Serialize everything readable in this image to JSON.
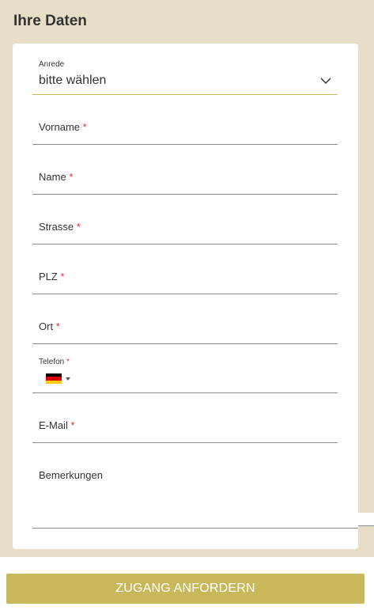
{
  "section": {
    "title": "Ihre Daten"
  },
  "form": {
    "anrede": {
      "label": "Anrede",
      "value": "bitte wählen"
    },
    "vorname": {
      "label": "Vorname",
      "required": "*"
    },
    "name": {
      "label": "Name",
      "required": "*"
    },
    "strasse": {
      "label": "Strasse",
      "required": "*"
    },
    "plz": {
      "label": "PLZ",
      "required": "*"
    },
    "ort": {
      "label": "Ort",
      "required": "*"
    },
    "telefon": {
      "label": "Telefon",
      "required": "*",
      "country_flag": "germany-flag-icon"
    },
    "email": {
      "label": "E-Mail",
      "required": "*"
    },
    "bemerkungen": {
      "label": "Bemerkungen"
    }
  },
  "actions": {
    "submit_label": "ZUGANG ANFORDERN"
  },
  "colors": {
    "background": "#e8dec8",
    "accent": "#c9b85a",
    "required": "#e03030",
    "select_underline": "#c9b85a"
  }
}
